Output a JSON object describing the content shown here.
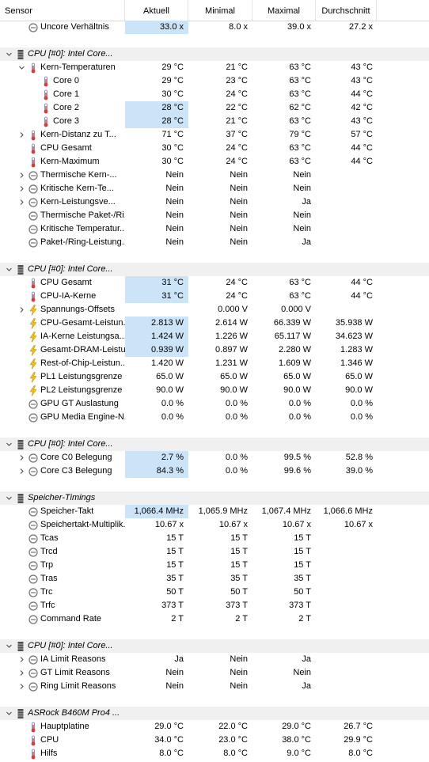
{
  "columns": [
    "Sensor",
    "Aktuell",
    "Minimal",
    "Maximal",
    "Durchschnitt"
  ],
  "rows": [
    {
      "type": "item",
      "indent": 1,
      "icon": "clock-icon",
      "name": "Uncore Verhältnis",
      "cur": "33.0 x",
      "min": "8.0 x",
      "max": "39.0 x",
      "avg": "27.2 x",
      "hl": true
    },
    {
      "type": "blank"
    },
    {
      "type": "group",
      "indent": 0,
      "exp": "down",
      "icon": "chip-icon",
      "name": "CPU [#0]: Intel Core..."
    },
    {
      "type": "item",
      "indent": 1,
      "exp": "down",
      "icon": "thermometer-icon",
      "name": "Kern-Temperaturen",
      "cur": "29 °C",
      "min": "21 °C",
      "max": "63 °C",
      "avg": "43 °C"
    },
    {
      "type": "item",
      "indent": 2,
      "icon": "thermometer-icon",
      "name": "Core 0",
      "cur": "29 °C",
      "min": "23 °C",
      "max": "63 °C",
      "avg": "43 °C"
    },
    {
      "type": "item",
      "indent": 2,
      "icon": "thermometer-icon",
      "name": "Core 1",
      "cur": "30 °C",
      "min": "24 °C",
      "max": "63 °C",
      "avg": "44 °C"
    },
    {
      "type": "item",
      "indent": 2,
      "icon": "thermometer-icon",
      "name": "Core 2",
      "cur": "28 °C",
      "min": "22 °C",
      "max": "62 °C",
      "avg": "42 °C",
      "hl": true
    },
    {
      "type": "item",
      "indent": 2,
      "icon": "thermometer-icon",
      "name": "Core 3",
      "cur": "28 °C",
      "min": "21 °C",
      "max": "63 °C",
      "avg": "43 °C",
      "hl": true
    },
    {
      "type": "item",
      "indent": 1,
      "exp": "right",
      "icon": "thermometer-icon",
      "name": "Kern-Distanz zu T...",
      "cur": "71 °C",
      "min": "37 °C",
      "max": "79 °C",
      "avg": "57 °C"
    },
    {
      "type": "item",
      "indent": 1,
      "icon": "thermometer-icon",
      "name": "CPU Gesamt",
      "cur": "30 °C",
      "min": "24 °C",
      "max": "63 °C",
      "avg": "44 °C"
    },
    {
      "type": "item",
      "indent": 1,
      "icon": "thermometer-icon",
      "name": "Kern-Maximum",
      "cur": "30 °C",
      "min": "24 °C",
      "max": "63 °C",
      "avg": "44 °C"
    },
    {
      "type": "item",
      "indent": 1,
      "exp": "right",
      "icon": "clock-icon",
      "name": "Thermische Kern-...",
      "cur": "Nein",
      "min": "Nein",
      "max": "Nein",
      "avg": ""
    },
    {
      "type": "item",
      "indent": 1,
      "exp": "right",
      "icon": "clock-icon",
      "name": "Kritische Kern-Te...",
      "cur": "Nein",
      "min": "Nein",
      "max": "Nein",
      "avg": ""
    },
    {
      "type": "item",
      "indent": 1,
      "exp": "right",
      "icon": "clock-icon",
      "name": "Kern-Leistungsve...",
      "cur": "Nein",
      "min": "Nein",
      "max": "Ja",
      "avg": ""
    },
    {
      "type": "item",
      "indent": 1,
      "icon": "clock-icon",
      "name": "Thermische Paket-/Ri...",
      "cur": "Nein",
      "min": "Nein",
      "max": "Nein",
      "avg": ""
    },
    {
      "type": "item",
      "indent": 1,
      "icon": "clock-icon",
      "name": "Kritische Temperatur...",
      "cur": "Nein",
      "min": "Nein",
      "max": "Nein",
      "avg": ""
    },
    {
      "type": "item",
      "indent": 1,
      "icon": "clock-icon",
      "name": "Paket-/Ring-Leistung...",
      "cur": "Nein",
      "min": "Nein",
      "max": "Ja",
      "avg": ""
    },
    {
      "type": "blank"
    },
    {
      "type": "group",
      "indent": 0,
      "exp": "down",
      "icon": "chip-icon",
      "name": "CPU [#0]: Intel Core..."
    },
    {
      "type": "item",
      "indent": 1,
      "icon": "thermometer-icon",
      "name": "CPU Gesamt",
      "cur": "31 °C",
      "min": "24 °C",
      "max": "63 °C",
      "avg": "44 °C",
      "hl": true
    },
    {
      "type": "item",
      "indent": 1,
      "icon": "thermometer-icon",
      "name": "CPU-IA-Kerne",
      "cur": "31 °C",
      "min": "24 °C",
      "max": "63 °C",
      "avg": "44 °C",
      "hl": true
    },
    {
      "type": "item",
      "indent": 1,
      "exp": "right",
      "icon": "lightning-icon",
      "name": "Spannungs-Offsets",
      "cur": "",
      "min": "0.000 V",
      "max": "0.000 V",
      "avg": ""
    },
    {
      "type": "item",
      "indent": 1,
      "icon": "lightning-icon",
      "name": "CPU-Gesamt-Leistun...",
      "cur": "2.813 W",
      "min": "2.614 W",
      "max": "66.339 W",
      "avg": "35.938 W",
      "hl": true
    },
    {
      "type": "item",
      "indent": 1,
      "icon": "lightning-icon",
      "name": "IA-Kerne Leistungsa...",
      "cur": "1.424 W",
      "min": "1.226 W",
      "max": "65.117 W",
      "avg": "34.623 W",
      "hl": true
    },
    {
      "type": "item",
      "indent": 1,
      "icon": "lightning-icon",
      "name": "Gesamt-DRAM-Leistung",
      "cur": "0.939 W",
      "min": "0.897 W",
      "max": "2.280 W",
      "avg": "1.283 W",
      "hl": true
    },
    {
      "type": "item",
      "indent": 1,
      "icon": "lightning-icon",
      "name": "Rest-of-Chip-Leistun...",
      "cur": "1.420 W",
      "min": "1.231 W",
      "max": "1.609 W",
      "avg": "1.346 W"
    },
    {
      "type": "item",
      "indent": 1,
      "icon": "lightning-icon",
      "name": "PL1 Leistungsgrenze",
      "cur": "65.0 W",
      "min": "65.0 W",
      "max": "65.0 W",
      "avg": "65.0 W"
    },
    {
      "type": "item",
      "indent": 1,
      "icon": "lightning-icon",
      "name": "PL2 Leistungsgrenze",
      "cur": "90.0 W",
      "min": "90.0 W",
      "max": "90.0 W",
      "avg": "90.0 W"
    },
    {
      "type": "item",
      "indent": 1,
      "icon": "clock-icon",
      "name": "GPU GT Auslastung",
      "cur": "0.0 %",
      "min": "0.0 %",
      "max": "0.0 %",
      "avg": "0.0 %"
    },
    {
      "type": "item",
      "indent": 1,
      "icon": "clock-icon",
      "name": "GPU Media Engine-N...",
      "cur": "0.0 %",
      "min": "0.0 %",
      "max": "0.0 %",
      "avg": "0.0 %"
    },
    {
      "type": "blank"
    },
    {
      "type": "group",
      "indent": 0,
      "exp": "down",
      "icon": "chip-icon",
      "name": "CPU [#0]: Intel Core..."
    },
    {
      "type": "item",
      "indent": 1,
      "exp": "right",
      "icon": "clock-icon",
      "name": "Core C0 Belegung",
      "cur": "2.7 %",
      "min": "0.0 %",
      "max": "99.5 %",
      "avg": "52.8 %",
      "hl": true
    },
    {
      "type": "item",
      "indent": 1,
      "exp": "right",
      "icon": "clock-icon",
      "name": "Core C3 Belegung",
      "cur": "84.3 %",
      "min": "0.0 %",
      "max": "99.6 %",
      "avg": "39.0 %",
      "hl": true
    },
    {
      "type": "blank"
    },
    {
      "type": "group",
      "indent": 0,
      "exp": "down",
      "icon": "chip-icon",
      "name": "Speicher-Timings"
    },
    {
      "type": "item",
      "indent": 1,
      "icon": "clock-icon",
      "name": "Speicher-Takt",
      "cur": "1,066.4 MHz",
      "min": "1,065.9 MHz",
      "max": "1,067.4 MHz",
      "avg": "1,066.6 MHz",
      "hl": true
    },
    {
      "type": "item",
      "indent": 1,
      "icon": "clock-icon",
      "name": "Speichertakt-Multiplik...",
      "cur": "10.67 x",
      "min": "10.67 x",
      "max": "10.67 x",
      "avg": "10.67 x"
    },
    {
      "type": "item",
      "indent": 1,
      "icon": "clock-icon",
      "name": "Tcas",
      "cur": "15 T",
      "min": "15 T",
      "max": "15 T",
      "avg": ""
    },
    {
      "type": "item",
      "indent": 1,
      "icon": "clock-icon",
      "name": "Trcd",
      "cur": "15 T",
      "min": "15 T",
      "max": "15 T",
      "avg": ""
    },
    {
      "type": "item",
      "indent": 1,
      "icon": "clock-icon",
      "name": "Trp",
      "cur": "15 T",
      "min": "15 T",
      "max": "15 T",
      "avg": ""
    },
    {
      "type": "item",
      "indent": 1,
      "icon": "clock-icon",
      "name": "Tras",
      "cur": "35 T",
      "min": "35 T",
      "max": "35 T",
      "avg": ""
    },
    {
      "type": "item",
      "indent": 1,
      "icon": "clock-icon",
      "name": "Trc",
      "cur": "50 T",
      "min": "50 T",
      "max": "50 T",
      "avg": ""
    },
    {
      "type": "item",
      "indent": 1,
      "icon": "clock-icon",
      "name": "Trfc",
      "cur": "373 T",
      "min": "373 T",
      "max": "373 T",
      "avg": ""
    },
    {
      "type": "item",
      "indent": 1,
      "icon": "clock-icon",
      "name": "Command Rate",
      "cur": "2 T",
      "min": "2 T",
      "max": "2 T",
      "avg": ""
    },
    {
      "type": "blank"
    },
    {
      "type": "group",
      "indent": 0,
      "exp": "down",
      "icon": "chip-icon",
      "name": "CPU [#0]: Intel Core..."
    },
    {
      "type": "item",
      "indent": 1,
      "exp": "right",
      "icon": "clock-icon",
      "name": "IA Limit Reasons",
      "cur": "Ja",
      "min": "Nein",
      "max": "Ja",
      "avg": ""
    },
    {
      "type": "item",
      "indent": 1,
      "exp": "right",
      "icon": "clock-icon",
      "name": "GT Limit Reasons",
      "cur": "Nein",
      "min": "Nein",
      "max": "Nein",
      "avg": ""
    },
    {
      "type": "item",
      "indent": 1,
      "exp": "right",
      "icon": "clock-icon",
      "name": "Ring Limit Reasons",
      "cur": "Nein",
      "min": "Nein",
      "max": "Ja",
      "avg": ""
    },
    {
      "type": "blank"
    },
    {
      "type": "group",
      "indent": 0,
      "exp": "down",
      "icon": "chip-icon",
      "name": "ASRock B460M Pro4 ..."
    },
    {
      "type": "item",
      "indent": 1,
      "icon": "thermometer-icon",
      "name": "Hauptplatine",
      "cur": "29.0 °C",
      "min": "22.0 °C",
      "max": "29.0 °C",
      "avg": "26.7 °C"
    },
    {
      "type": "item",
      "indent": 1,
      "icon": "thermometer-icon",
      "name": "CPU",
      "cur": "34.0 °C",
      "min": "23.0 °C",
      "max": "38.0 °C",
      "avg": "29.9 °C"
    },
    {
      "type": "item",
      "indent": 1,
      "icon": "thermometer-icon",
      "name": "Hilfs",
      "cur": "8.0 °C",
      "min": "8.0 °C",
      "max": "9.0 °C",
      "avg": "8.0 °C"
    }
  ],
  "colors": {
    "highlight": "#cce4f7",
    "group_bg": "#f0f0f0",
    "thermometer": "#d83b3b",
    "lightning": "#f2c010",
    "clock": "#707070",
    "chip": "#505050"
  }
}
